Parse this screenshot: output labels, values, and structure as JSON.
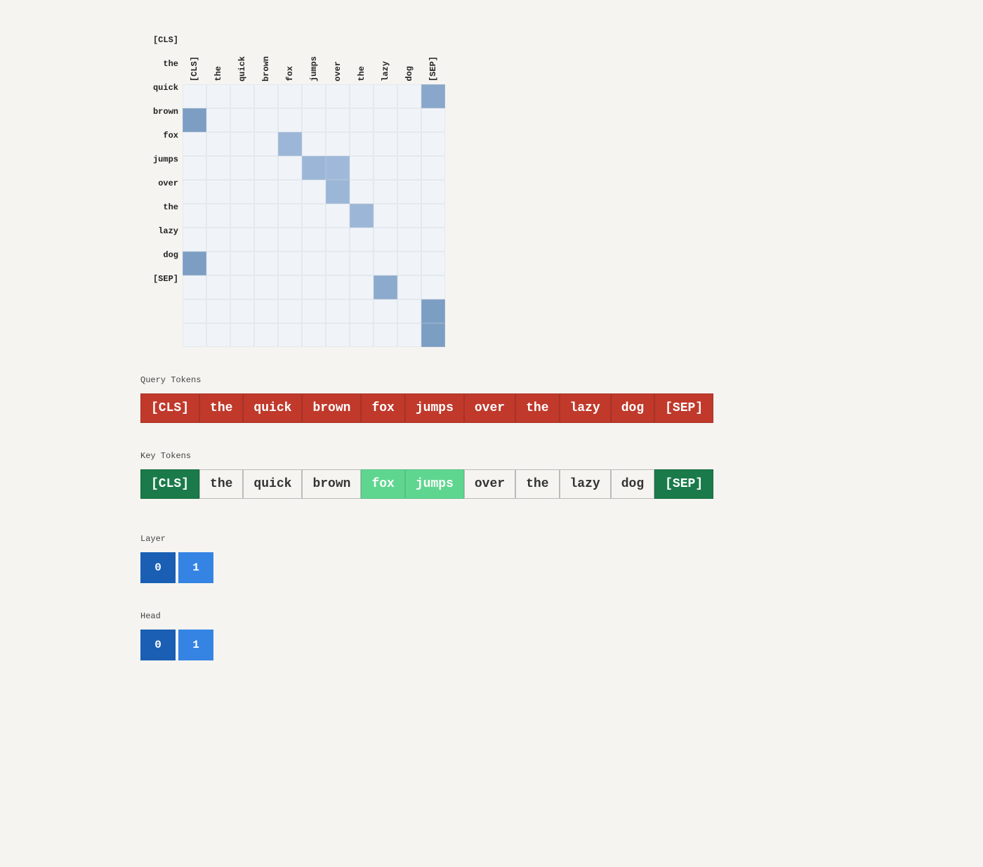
{
  "matrix": {
    "col_labels": [
      "[CLS]",
      "the",
      "quick",
      "brown",
      "fox",
      "jumps",
      "over",
      "the",
      "lazy",
      "dog",
      "[SEP]"
    ],
    "row_labels": [
      "[CLS]",
      "the",
      "quick",
      "brown",
      "fox",
      "jumps",
      "over",
      "the",
      "lazy",
      "dog",
      "[SEP]"
    ],
    "cells": [
      [
        0.05,
        0.05,
        0.05,
        0.05,
        0.05,
        0.05,
        0.05,
        0.05,
        0.05,
        0.05,
        0.55
      ],
      [
        0.7,
        0.05,
        0.05,
        0.05,
        0.05,
        0.05,
        0.05,
        0.05,
        0.05,
        0.05,
        0.05
      ],
      [
        0.05,
        0.05,
        0.05,
        0.05,
        0.3,
        0.05,
        0.05,
        0.05,
        0.05,
        0.05,
        0.05
      ],
      [
        0.05,
        0.05,
        0.05,
        0.05,
        0.05,
        0.3,
        0.25,
        0.05,
        0.05,
        0.05,
        0.05
      ],
      [
        0.05,
        0.05,
        0.05,
        0.05,
        0.05,
        0.05,
        0.3,
        0.05,
        0.05,
        0.05,
        0.05
      ],
      [
        0.05,
        0.05,
        0.05,
        0.05,
        0.05,
        0.05,
        0.05,
        0.3,
        0.05,
        0.05,
        0.05
      ],
      [
        0.05,
        0.05,
        0.05,
        0.05,
        0.05,
        0.05,
        0.05,
        0.05,
        0.05,
        0.05,
        0.05
      ],
      [
        0.7,
        0.05,
        0.05,
        0.05,
        0.05,
        0.05,
        0.05,
        0.05,
        0.05,
        0.05,
        0.05
      ],
      [
        0.05,
        0.05,
        0.05,
        0.05,
        0.05,
        0.05,
        0.05,
        0.05,
        0.5,
        0.05,
        0.05
      ],
      [
        0.05,
        0.05,
        0.05,
        0.05,
        0.05,
        0.05,
        0.05,
        0.05,
        0.05,
        0.05,
        0.7
      ],
      [
        0.05,
        0.05,
        0.05,
        0.05,
        0.05,
        0.05,
        0.05,
        0.05,
        0.05,
        0.05,
        0.7
      ]
    ]
  },
  "query_tokens": {
    "label": "Query Tokens",
    "tokens": [
      "[CLS]",
      "the",
      "quick",
      "brown",
      "fox",
      "jumps",
      "over",
      "the",
      "lazy",
      "dog",
      "[SEP]"
    ]
  },
  "key_tokens": {
    "label": "Key Tokens",
    "tokens": [
      {
        "text": "[CLS]",
        "style": "cls"
      },
      {
        "text": "the",
        "style": "plain"
      },
      {
        "text": "quick",
        "style": "plain"
      },
      {
        "text": "brown",
        "style": "plain"
      },
      {
        "text": "fox",
        "style": "fox"
      },
      {
        "text": "jumps",
        "style": "jumps"
      },
      {
        "text": "over",
        "style": "plain"
      },
      {
        "text": "the",
        "style": "plain"
      },
      {
        "text": "lazy",
        "style": "plain"
      },
      {
        "text": "dog",
        "style": "plain"
      },
      {
        "text": "[SEP]",
        "style": "sep"
      }
    ]
  },
  "layer": {
    "label": "Layer",
    "buttons": [
      "0",
      "1"
    ],
    "active": 0
  },
  "head": {
    "label": "Head",
    "buttons": [
      "0",
      "1"
    ],
    "active": 0
  }
}
